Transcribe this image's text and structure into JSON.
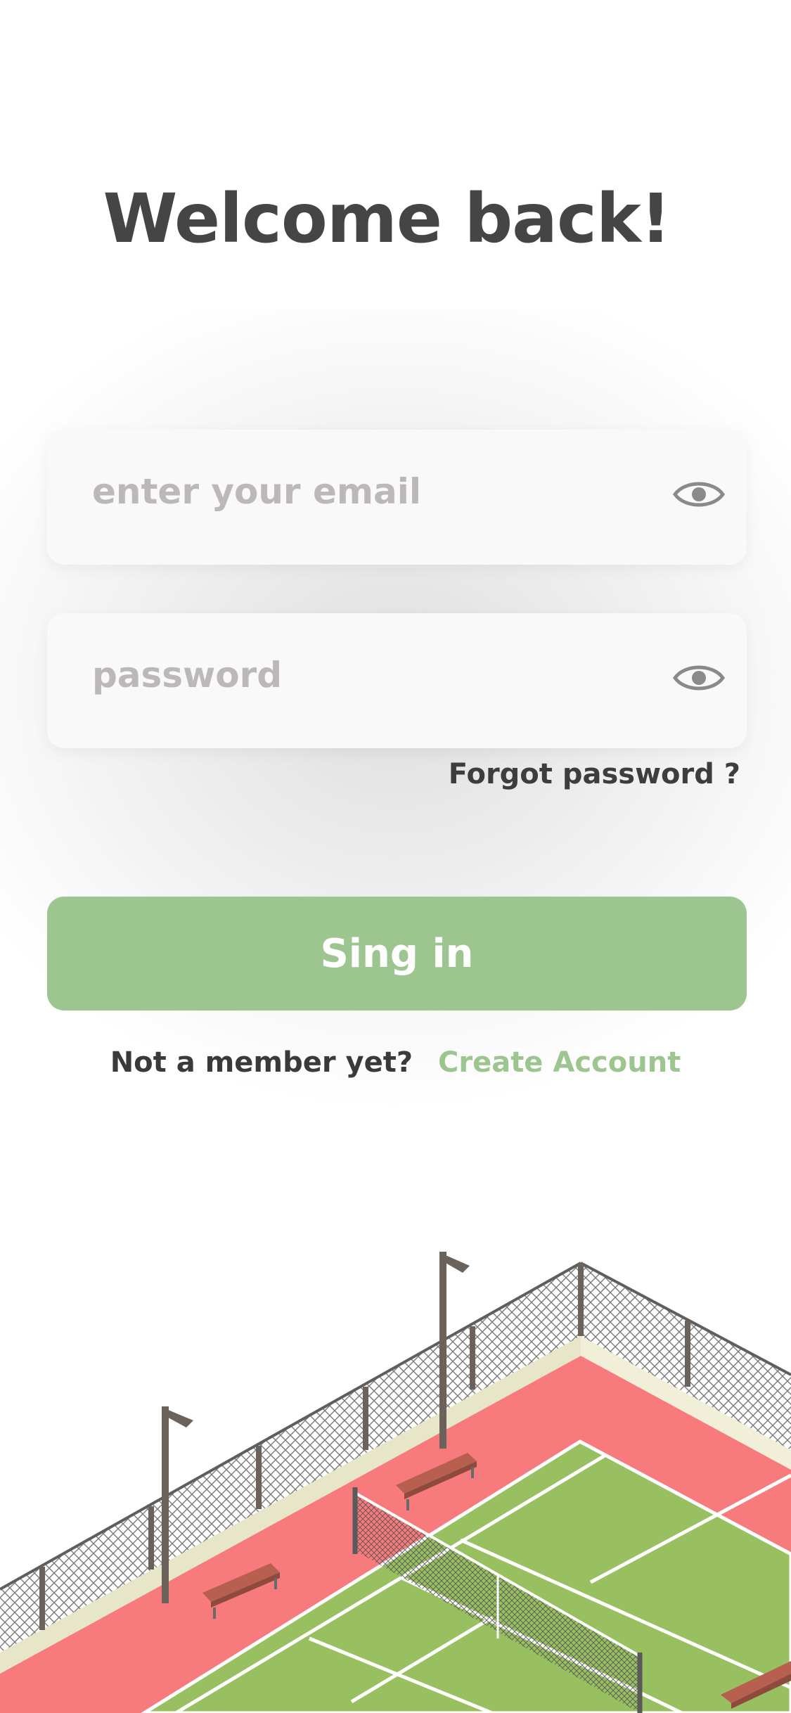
{
  "title": "Welcome back!",
  "email": {
    "placeholder": "enter your email",
    "icon": "eye-icon"
  },
  "password": {
    "placeholder": "password",
    "icon": "eye-icon"
  },
  "forgot_label": "Forgot password ?",
  "signin_label": "Sing in",
  "member_question": "Not a member yet?",
  "create_account_label": "Create Account",
  "colors": {
    "accent": "#9dc590",
    "text_dark": "#454545",
    "placeholder": "#bdb8b8",
    "court_outer": "#f77b7d",
    "court_inner": "#98c060"
  }
}
